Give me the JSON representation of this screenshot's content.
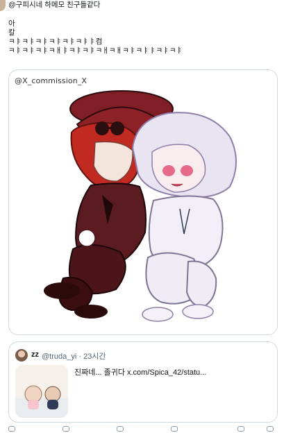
{
  "tweet": {
    "text": "@구피시네 하메모 친구들같다\n\n아\n칼\nㅋㅑㅋㅑㅋㅑㅋㅑㅋㅑㅋㅑㅑ컴\nㅋㅑㅋㅑㅋㅑㅋㅐㅑㅋㅑㅋㅑㅋㅐㅋㅐㅋㅑㅋㅑㅑㅋㅑㅋㅑ"
  },
  "media": {
    "handle": "@X_commission_X",
    "description_icon": "artwork-image"
  },
  "quote": {
    "name": "zz",
    "handle_time": "@truda_yi · 23시간",
    "text": "진짜네... 졸귀다 x.com/Spica_42/statu..."
  },
  "actions": {
    "icons": [
      "reply-icon",
      "retweet-icon",
      "like-icon",
      "views-icon",
      "bookmark-icon",
      "share-icon"
    ]
  },
  "colors": {
    "border": "#cfd9de",
    "secondary_text": "#536471",
    "hat_red": "#7a1f24",
    "hair_red": "#c42a1f",
    "suit_dark": "#5b1e22"
  }
}
